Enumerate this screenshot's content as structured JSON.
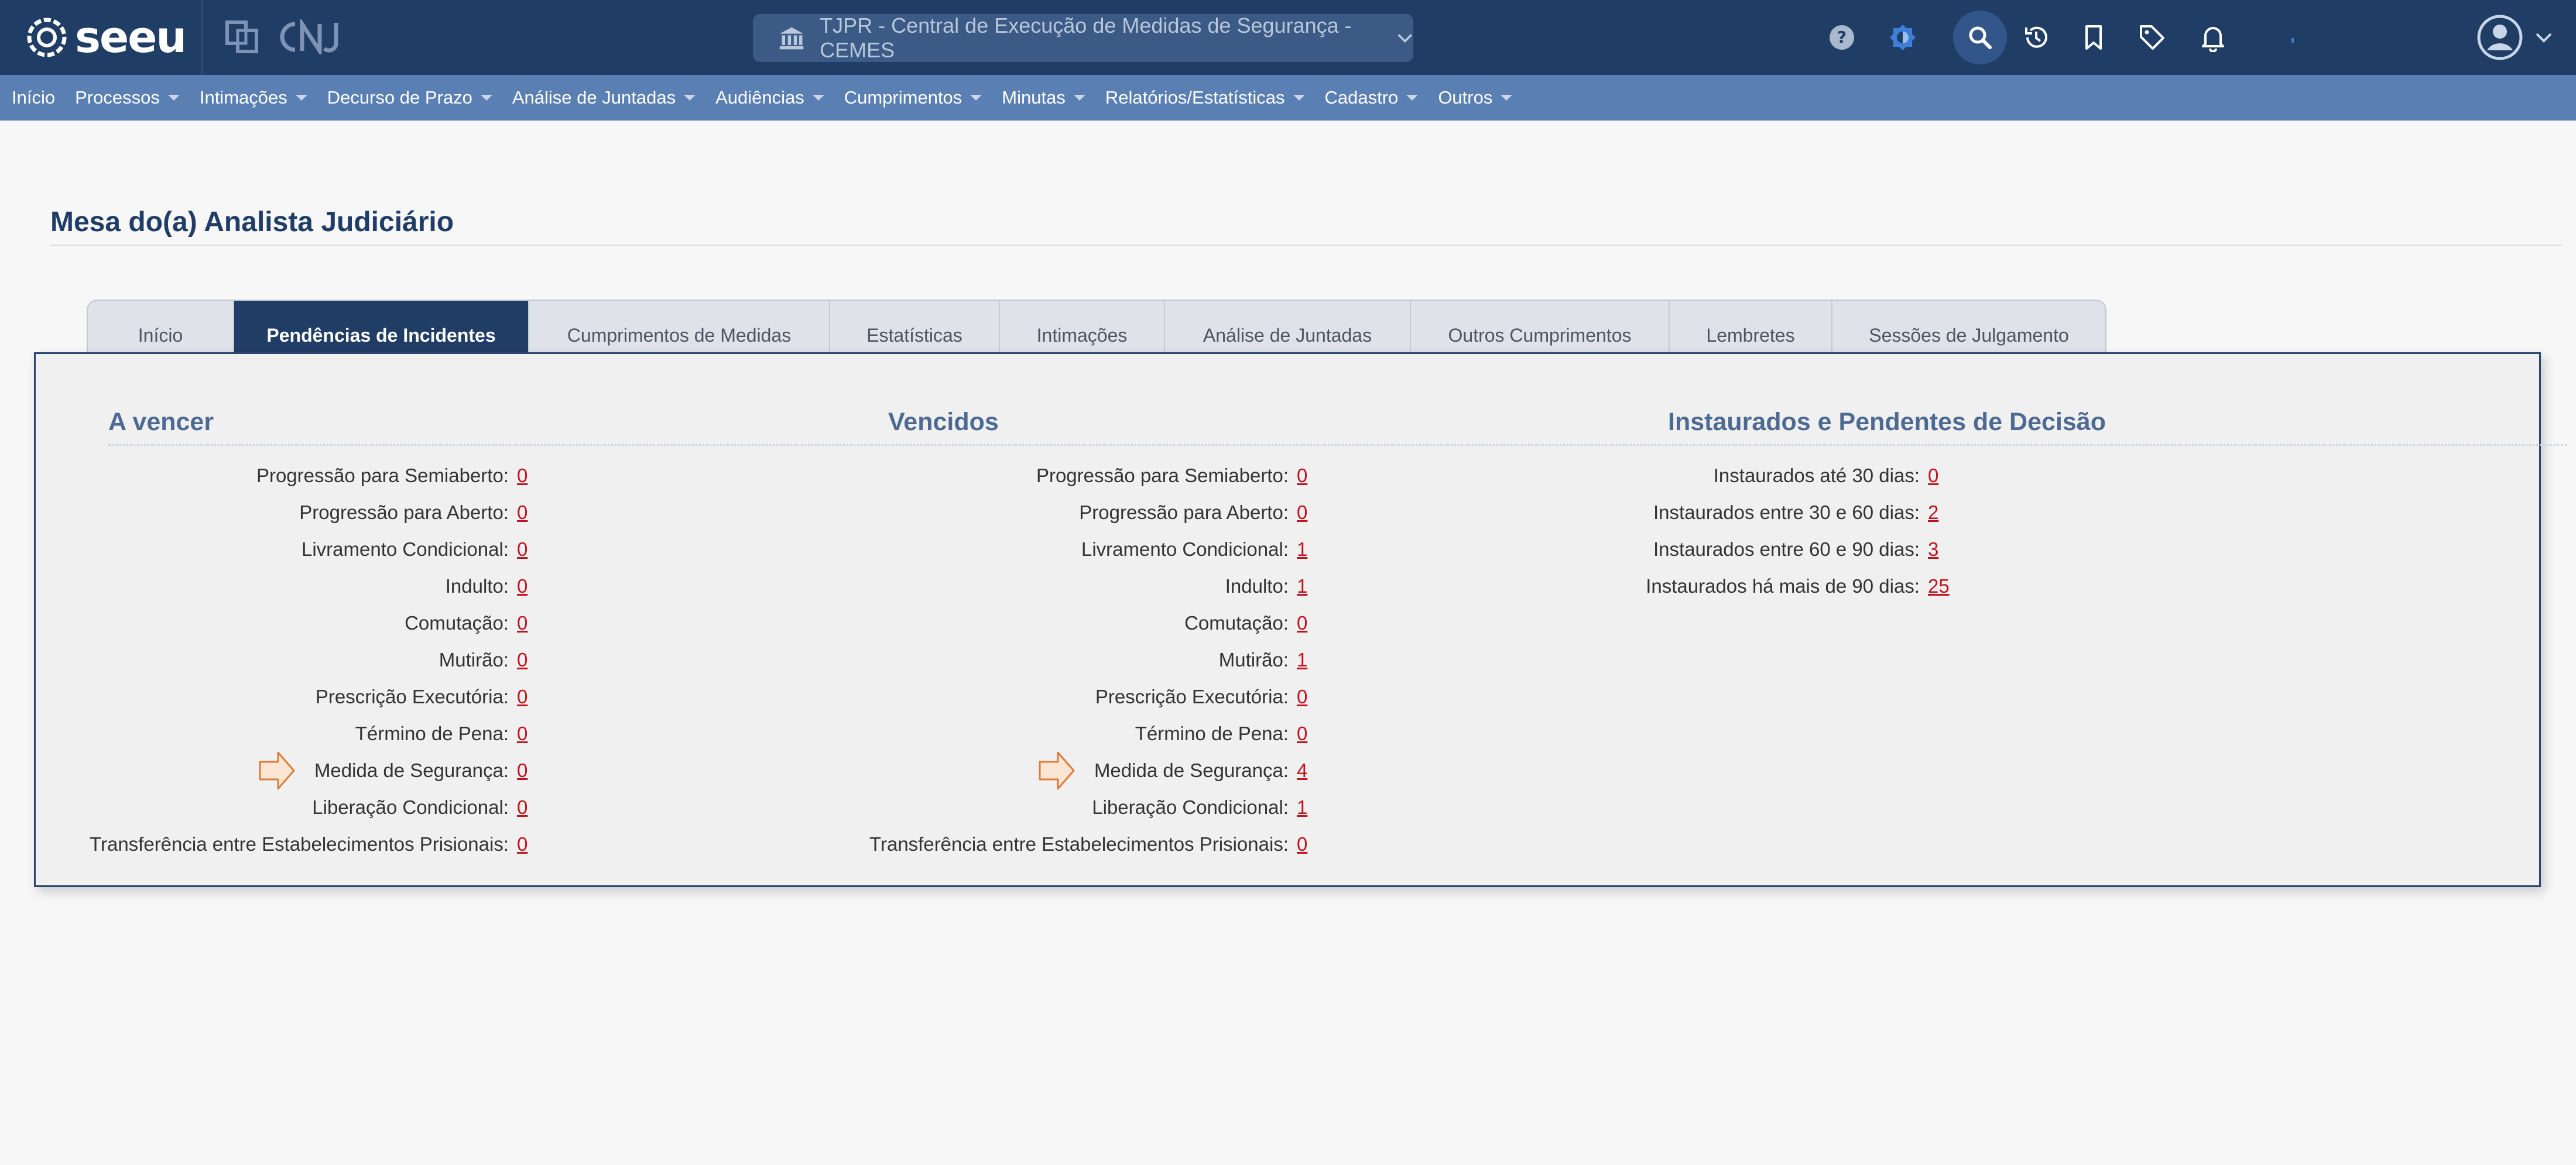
{
  "app": {
    "logo_text": "seeu",
    "court_selector": "TJPR - Central de Execução de Medidas de Segurança - CEMES"
  },
  "colors": {
    "topbar": "#203d66",
    "menubar": "#5a7fb3",
    "link_value": "#c1121f",
    "section_heading": "#4d6a93",
    "arrow": "#e07b39"
  },
  "top_icons": [
    "help-icon",
    "theme-icon",
    "search-icon",
    "history-icon",
    "bookmark-icon",
    "tag-icon",
    "bell-icon",
    "user-avatar-icon"
  ],
  "menu": [
    {
      "label": "Início",
      "caret": false
    },
    {
      "label": "Processos",
      "caret": true
    },
    {
      "label": "Intimações",
      "caret": true
    },
    {
      "label": "Decurso de Prazo",
      "caret": true
    },
    {
      "label": "Análise de Juntadas",
      "caret": true
    },
    {
      "label": "Audiências",
      "caret": true
    },
    {
      "label": "Cumprimentos",
      "caret": true
    },
    {
      "label": "Minutas",
      "caret": true
    },
    {
      "label": "Relatórios/Estatísticas",
      "caret": true
    },
    {
      "label": "Cadastro",
      "caret": true
    },
    {
      "label": "Outros",
      "caret": true
    }
  ],
  "page_title": "Mesa do(a) Analista Judiciário",
  "tabs": [
    {
      "label": "Início",
      "active": false
    },
    {
      "label": "Pendências de Incidentes",
      "active": true
    },
    {
      "label": "Cumprimentos de Medidas",
      "active": false
    },
    {
      "label": "Estatísticas",
      "active": false
    },
    {
      "label": "Intimações",
      "active": false
    },
    {
      "label": "Análise de Juntadas",
      "active": false
    },
    {
      "label": "Outros Cumprimentos",
      "active": false
    },
    {
      "label": "Lembretes",
      "active": false
    },
    {
      "label": "Sessões de Julgamento",
      "active": false
    }
  ],
  "sections": [
    {
      "heading": "A vencer",
      "rows": [
        {
          "label": "Progressão para Semiaberto:",
          "value": "0"
        },
        {
          "label": "Progressão para Aberto:",
          "value": "0"
        },
        {
          "label": "Livramento Condicional:",
          "value": "0"
        },
        {
          "label": "Indulto:",
          "value": "0"
        },
        {
          "label": "Comutação:",
          "value": "0"
        },
        {
          "label": "Mutirão:",
          "value": "0"
        },
        {
          "label": "Prescrição Executória:",
          "value": "0"
        },
        {
          "label": "Término de Pena:",
          "value": "0"
        },
        {
          "label": "Medida de Segurança:",
          "value": "0",
          "highlight": true
        },
        {
          "label": "Liberação Condicional:",
          "value": "0"
        },
        {
          "label": "Transferência entre Estabelecimentos Prisionais:",
          "value": "0"
        }
      ]
    },
    {
      "heading": "Vencidos",
      "rows": [
        {
          "label": "Progressão para Semiaberto:",
          "value": "0"
        },
        {
          "label": "Progressão para Aberto:",
          "value": "0"
        },
        {
          "label": "Livramento Condicional:",
          "value": "1"
        },
        {
          "label": "Indulto:",
          "value": "1"
        },
        {
          "label": "Comutação:",
          "value": "0"
        },
        {
          "label": "Mutirão:",
          "value": "1"
        },
        {
          "label": "Prescrição Executória:",
          "value": "0"
        },
        {
          "label": "Término de Pena:",
          "value": "0"
        },
        {
          "label": "Medida de Segurança:",
          "value": "4",
          "highlight": true
        },
        {
          "label": "Liberação Condicional:",
          "value": "1"
        },
        {
          "label": "Transferência entre Estabelecimentos Prisionais:",
          "value": "0"
        }
      ]
    },
    {
      "heading": "Instaurados e Pendentes de Decisão",
      "rows": [
        {
          "label": "Instaurados até 30 dias:",
          "value": "0"
        },
        {
          "label": "Instaurados entre 30 e 60 dias:",
          "value": "2"
        },
        {
          "label": "Instaurados entre 60 e 90 dias:",
          "value": "3"
        },
        {
          "label": "Instaurados há mais de 90 dias:",
          "value": "25"
        }
      ]
    }
  ]
}
